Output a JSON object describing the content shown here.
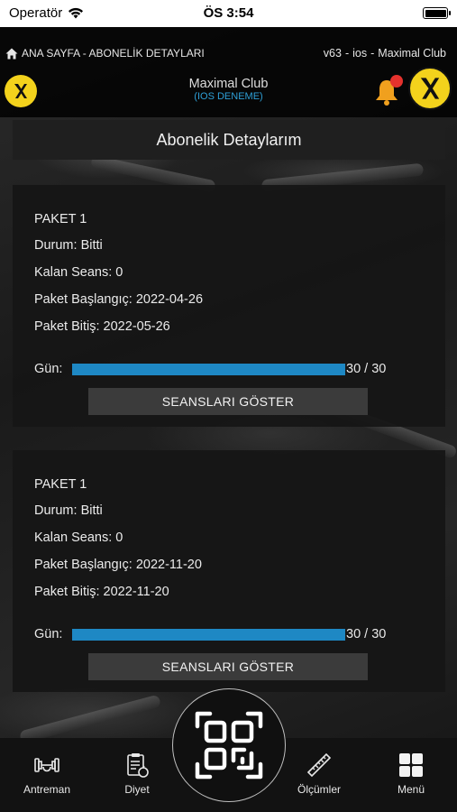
{
  "status_bar": {
    "carrier": "Operatör",
    "time": "ÖS 3:54"
  },
  "header": {
    "breadcrumb": "ANA SAYFA - ABONELİK DETAYLARI",
    "version": "v63",
    "platform": "ios",
    "club_label": "Maximal Club",
    "title": "Maximal Club",
    "subtitle": "(IOS DENEME)"
  },
  "page": {
    "title": "Abonelik Detaylarım"
  },
  "packages": [
    {
      "name": "PAKET 1",
      "status": "Durum: Bitti",
      "remaining": "Kalan Seans: 0",
      "start": "Paket Başlangıç: 2022-04-26",
      "end": "Paket Bitiş: 2022-05-26",
      "days_label": "Gün:",
      "days_text": "30 / 30",
      "days_progress": 1.0,
      "button_label": "SEANSLARI GÖSTER"
    },
    {
      "name": "PAKET 1",
      "status": "Durum: Bitti",
      "remaining": "Kalan Seans: 0",
      "start": "Paket Başlangıç: 2022-11-20",
      "end": "Paket Bitiş: 2022-11-20",
      "days_label": "Gün:",
      "days_text": "30 / 30",
      "days_progress": 1.0,
      "button_label": "SEANSLARI GÖSTER"
    }
  ],
  "tabbar": {
    "training": "Antreman",
    "diet": "Diyet",
    "measurements": "Ölçümler",
    "menu": "Menü"
  },
  "colors": {
    "accent_blue": "#1e88c4",
    "logo_yellow": "#f3d21c",
    "notification_red": "#e5322d",
    "subtitle_blue": "#2e9fd6"
  }
}
